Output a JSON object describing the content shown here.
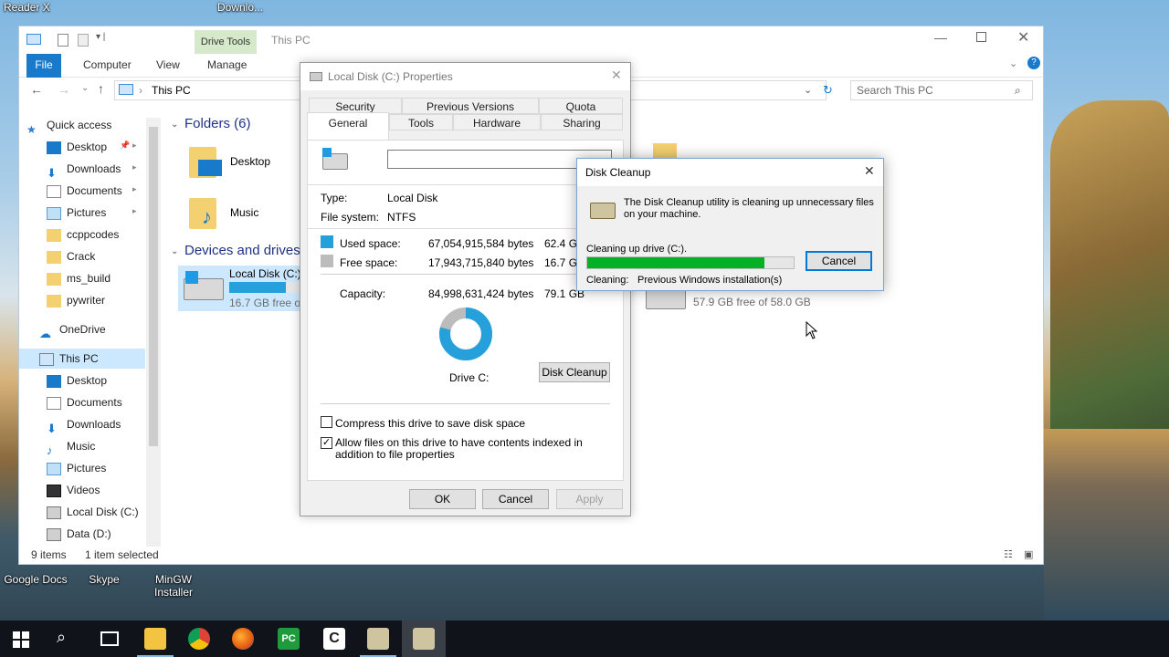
{
  "desktop": {
    "top_labels": [
      "Reader X",
      "Downlo..."
    ],
    "bottom_labels": [
      "Google Docs",
      "Skype",
      "MinGW Installer"
    ]
  },
  "explorer": {
    "title": "This PC",
    "drive_tools": "Drive Tools",
    "tabs": {
      "file": "File",
      "computer": "Computer",
      "view": "View",
      "manage": "Manage"
    },
    "address": "This PC",
    "search_placeholder": "Search This PC",
    "nav": {
      "quick_access": "Quick access",
      "items": [
        {
          "label": "Desktop",
          "icon": "desktop-icon"
        },
        {
          "label": "Downloads",
          "icon": "downloads-icon"
        },
        {
          "label": "Documents",
          "icon": "documents-icon"
        },
        {
          "label": "Pictures",
          "icon": "pictures-icon"
        },
        {
          "label": "ccppcodes",
          "icon": "folder-icon"
        },
        {
          "label": "Crack",
          "icon": "folder-icon"
        },
        {
          "label": "ms_build",
          "icon": "folder-icon"
        },
        {
          "label": "pywriter",
          "icon": "folder-icon"
        }
      ],
      "onedrive": "OneDrive",
      "this_pc": "This PC",
      "pc_items": [
        {
          "label": "Desktop",
          "icon": "desktop-icon"
        },
        {
          "label": "Documents",
          "icon": "documents-icon"
        },
        {
          "label": "Downloads",
          "icon": "downloads-icon"
        },
        {
          "label": "Music",
          "icon": "music-icon"
        },
        {
          "label": "Pictures",
          "icon": "pictures-icon"
        },
        {
          "label": "Videos",
          "icon": "videos-icon"
        },
        {
          "label": "Local Disk (C:)",
          "icon": "drive-icon"
        },
        {
          "label": "Data (D:)",
          "icon": "drive-icon"
        }
      ]
    },
    "folders_header": "Folders (6)",
    "folders": [
      "Desktop",
      "Music"
    ],
    "devices_header": "Devices and drives",
    "drive_c": {
      "name": "Local Disk (C:)",
      "free": "16.7 GB free of",
      "used_fraction": 0.79
    },
    "drive_d": {
      "free": "57.9 GB free of 58.0 GB"
    },
    "status": {
      "items": "9 items",
      "selected": "1 item selected"
    }
  },
  "properties": {
    "title": "Local Disk (C:) Properties",
    "tabs_row1": [
      "Security",
      "Previous Versions",
      "Quota"
    ],
    "tabs_row2": [
      "General",
      "Tools",
      "Hardware",
      "Sharing"
    ],
    "name_value": "",
    "type_label": "Type:",
    "type_value": "Local Disk",
    "fs_label": "File system:",
    "fs_value": "NTFS",
    "used_label": "Used space:",
    "used_bytes": "67,054,915,584 bytes",
    "used_gb": "62.4 GB",
    "free_label": "Free space:",
    "free_bytes": "17,943,715,840 bytes",
    "free_gb": "16.7 GB",
    "capacity_label": "Capacity:",
    "capacity_bytes": "84,998,631,424 bytes",
    "capacity_gb": "79.1 GB",
    "drive_label": "Drive C:",
    "disk_cleanup_btn": "Disk Cleanup",
    "compress_label": "Compress this drive to save disk space",
    "compress_checked": false,
    "index_label": "Allow files on this drive to have contents indexed in addition to file properties",
    "index_checked": true,
    "ok": "OK",
    "cancel": "Cancel",
    "apply": "Apply",
    "colors": {
      "used": "#26a0da",
      "free": "#bcbcbc"
    }
  },
  "cleanup": {
    "title": "Disk Cleanup",
    "message": "The Disk Cleanup utility is cleaning up unnecessary files on your machine.",
    "progress_label": "Cleaning up drive  (C:).",
    "progress": 0.86,
    "cleaning_label": "Cleaning:",
    "cleaning_item": "Previous Windows installation(s)",
    "cancel": "Cancel",
    "progress_color": "#06b025"
  },
  "taskbar": {
    "icons": [
      "start-icon",
      "search-icon",
      "task-view-icon",
      "file-explorer-icon",
      "chrome-icon",
      "firefox-icon",
      "pycharm-icon",
      "codeblocks-icon",
      "disk-cleanup-icon",
      "disk-cleanup-active-icon"
    ]
  }
}
